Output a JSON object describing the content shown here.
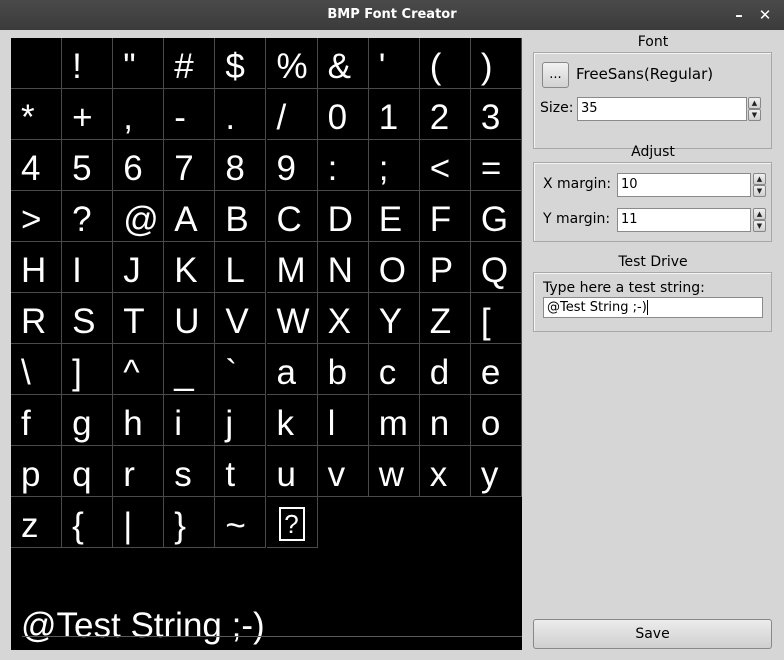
{
  "window": {
    "title": "BMP Font Creator",
    "minimize_glyph": "✕",
    "close_glyph": "✕"
  },
  "glyphs": [
    " ",
    "!",
    "\"",
    "#",
    "$",
    "%",
    "&",
    "'",
    "(",
    ")",
    "*",
    "+",
    ",",
    "-",
    ".",
    "/",
    "0",
    "1",
    "2",
    "3",
    "4",
    "5",
    "6",
    "7",
    "8",
    "9",
    ":",
    ";",
    "<",
    "=",
    ">",
    "?",
    "@",
    "A",
    "B",
    "C",
    "D",
    "E",
    "F",
    "G",
    "H",
    "I",
    "J",
    "K",
    "L",
    "M",
    "N",
    "O",
    "P",
    "Q",
    "R",
    "S",
    "T",
    "U",
    "V",
    "W",
    "X",
    "Y",
    "Z",
    "[",
    "\\",
    "]",
    "^",
    "_",
    "`",
    "a",
    "b",
    "c",
    "d",
    "e",
    "f",
    "g",
    "h",
    "i",
    "j",
    "k",
    "l",
    "m",
    "n",
    "o",
    "p",
    "q",
    "r",
    "s",
    "t",
    "u",
    "v",
    "w",
    "x",
    "y",
    "z",
    "{",
    "|",
    "}",
    "~",
    "?"
  ],
  "grid": {
    "columns": 10,
    "rows": 10,
    "unknown_glyph_index": 95
  },
  "font_section": {
    "heading": "Font",
    "browse_label": "...",
    "font_name": "FreeSans(Regular)",
    "size_label": "Size:",
    "size_value": "35"
  },
  "adjust_section": {
    "heading": "Adjust",
    "x_margin_label": "X margin:",
    "x_margin_value": "10",
    "y_margin_label": "Y margin:",
    "y_margin_value": "11"
  },
  "test_section": {
    "heading": "Test Drive",
    "prompt": "Type here a test string:",
    "value": "@Test String ;-)"
  },
  "preview_text": "@Test String ;-)",
  "save_label": "Save",
  "colors": {
    "titlebar": "#3f3f3f",
    "panel_background": "#000000",
    "glyph_color": "#ffffff",
    "window_background": "#d6d6d6"
  }
}
